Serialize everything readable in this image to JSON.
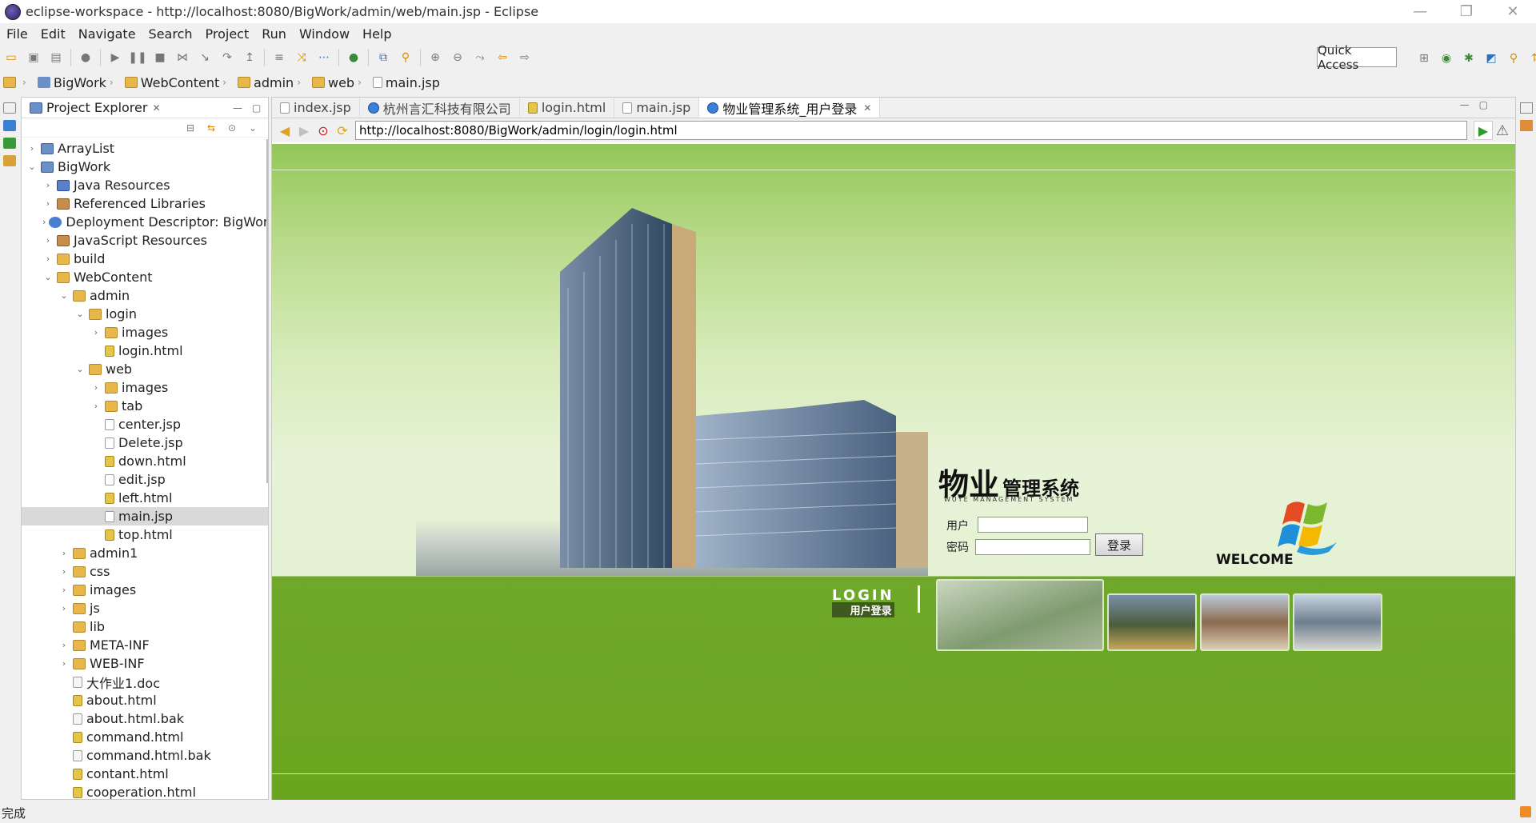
{
  "window": {
    "title": "eclipse-workspace - http://localhost:8080/BigWork/admin/web/main.jsp - Eclipse",
    "minimize": "—",
    "restore": "❐",
    "close": "✕"
  },
  "menu": [
    "File",
    "Edit",
    "Navigate",
    "Search",
    "Project",
    "Run",
    "Window",
    "Help"
  ],
  "quick_access": "Quick Access",
  "breadcrumb": [
    "BigWork",
    "WebContent",
    "admin",
    "web",
    "main.jsp"
  ],
  "explorer": {
    "title": "Project Explorer",
    "tree": [
      {
        "label": "ArrayList",
        "depth": 0,
        "twisty": "›",
        "icon": "proj"
      },
      {
        "label": "BigWork",
        "depth": 0,
        "twisty": "⌄",
        "icon": "proj"
      },
      {
        "label": "Java Resources",
        "depth": 1,
        "twisty": "›",
        "icon": "java"
      },
      {
        "label": "Referenced Libraries",
        "depth": 1,
        "twisty": "›",
        "icon": "lib"
      },
      {
        "label": "Deployment Descriptor: BigWork",
        "depth": 1,
        "twisty": "›",
        "icon": "dd"
      },
      {
        "label": "JavaScript Resources",
        "depth": 1,
        "twisty": "›",
        "icon": "lib"
      },
      {
        "label": "build",
        "depth": 1,
        "twisty": "›",
        "icon": "folder"
      },
      {
        "label": "WebContent",
        "depth": 1,
        "twisty": "⌄",
        "icon": "folder"
      },
      {
        "label": "admin",
        "depth": 2,
        "twisty": "⌄",
        "icon": "folder"
      },
      {
        "label": "login",
        "depth": 3,
        "twisty": "⌄",
        "icon": "folder"
      },
      {
        "label": "images",
        "depth": 4,
        "twisty": "›",
        "icon": "folder"
      },
      {
        "label": "login.html",
        "depth": 4,
        "twisty": "",
        "icon": "html"
      },
      {
        "label": "web",
        "depth": 3,
        "twisty": "⌄",
        "icon": "folder"
      },
      {
        "label": "images",
        "depth": 4,
        "twisty": "›",
        "icon": "folder"
      },
      {
        "label": "tab",
        "depth": 4,
        "twisty": "›",
        "icon": "folder"
      },
      {
        "label": "center.jsp",
        "depth": 4,
        "twisty": "",
        "icon": "jsp"
      },
      {
        "label": "Delete.jsp",
        "depth": 4,
        "twisty": "",
        "icon": "jsp"
      },
      {
        "label": "down.html",
        "depth": 4,
        "twisty": "",
        "icon": "html"
      },
      {
        "label": "edit.jsp",
        "depth": 4,
        "twisty": "",
        "icon": "jsp"
      },
      {
        "label": "left.html",
        "depth": 4,
        "twisty": "",
        "icon": "html"
      },
      {
        "label": "main.jsp",
        "depth": 4,
        "twisty": "",
        "icon": "jsp",
        "selected": true
      },
      {
        "label": "top.html",
        "depth": 4,
        "twisty": "",
        "icon": "html"
      },
      {
        "label": "admin1",
        "depth": 2,
        "twisty": "›",
        "icon": "folder"
      },
      {
        "label": "css",
        "depth": 2,
        "twisty": "›",
        "icon": "folder"
      },
      {
        "label": "images",
        "depth": 2,
        "twisty": "›",
        "icon": "folder"
      },
      {
        "label": "js",
        "depth": 2,
        "twisty": "›",
        "icon": "folder"
      },
      {
        "label": "lib",
        "depth": 2,
        "twisty": "",
        "icon": "folder"
      },
      {
        "label": "META-INF",
        "depth": 2,
        "twisty": "›",
        "icon": "folder"
      },
      {
        "label": "WEB-INF",
        "depth": 2,
        "twisty": "›",
        "icon": "folder"
      },
      {
        "label": "大作业1.doc",
        "depth": 2,
        "twisty": "",
        "icon": "doc"
      },
      {
        "label": "about.html",
        "depth": 2,
        "twisty": "",
        "icon": "html"
      },
      {
        "label": "about.html.bak",
        "depth": 2,
        "twisty": "",
        "icon": "doc"
      },
      {
        "label": "command.html",
        "depth": 2,
        "twisty": "",
        "icon": "html"
      },
      {
        "label": "command.html.bak",
        "depth": 2,
        "twisty": "",
        "icon": "doc"
      },
      {
        "label": "contant.html",
        "depth": 2,
        "twisty": "",
        "icon": "html"
      },
      {
        "label": "cooperation.html",
        "depth": 2,
        "twisty": "",
        "icon": "html"
      }
    ]
  },
  "editor_tabs": [
    {
      "label": "index.jsp",
      "icon": "jsp"
    },
    {
      "label": "杭州言汇科技有限公司",
      "icon": "globe"
    },
    {
      "label": "login.html",
      "icon": "html"
    },
    {
      "label": "main.jsp",
      "icon": "jsp"
    },
    {
      "label": "物业管理系统_用户登录",
      "icon": "globe",
      "active": true
    }
  ],
  "browser": {
    "url": "http://localhost:8080/BigWork/admin/login/login.html"
  },
  "login_page": {
    "title_big": "物业",
    "title_small": "管理系统",
    "subtitle": "WUYE MANAGEMENT SYSTEM",
    "user_label": "用户",
    "password_label": "密码",
    "button": "登录",
    "logo_en": "LOGIN",
    "logo_cn": "用户登录",
    "welcome": "WELCOME"
  },
  "status": "完成",
  "colors": {
    "page_green": "#6aa51f",
    "accent_blue": "#2d6fc0"
  }
}
